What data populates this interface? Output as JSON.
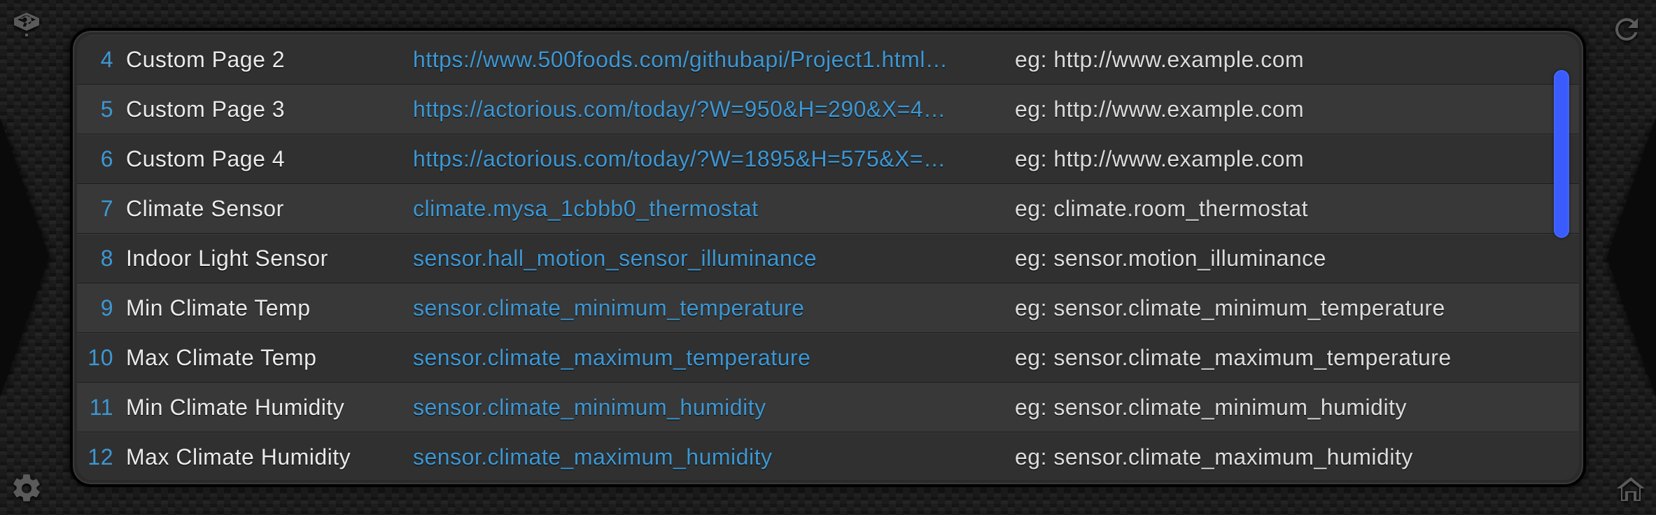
{
  "rows": [
    {
      "index": "4",
      "label": "Custom Page 2",
      "value": "https://www.500foods.com/githubapi/Project1.html…",
      "example": "eg: http://www.example.com"
    },
    {
      "index": "5",
      "label": "Custom Page 3",
      "value": "https://actorious.com/today/?W=950&H=290&X=4…",
      "example": "eg: http://www.example.com"
    },
    {
      "index": "6",
      "label": "Custom Page 4",
      "value": "https://actorious.com/today/?W=1895&H=575&X=…",
      "example": "eg: http://www.example.com"
    },
    {
      "index": "7",
      "label": "Climate Sensor",
      "value": "climate.mysa_1cbbb0_thermostat",
      "example": "eg: climate.room_thermostat"
    },
    {
      "index": "8",
      "label": "Indoor Light Sensor",
      "value": "sensor.hall_motion_sensor_illuminance",
      "example": "eg: sensor.motion_illuminance"
    },
    {
      "index": "9",
      "label": "Min Climate Temp",
      "value": "sensor.climate_minimum_temperature",
      "example": "eg: sensor.climate_minimum_temperature"
    },
    {
      "index": "10",
      "label": "Max Climate Temp",
      "value": "sensor.climate_maximum_temperature",
      "example": "eg: sensor.climate_maximum_temperature"
    },
    {
      "index": "11",
      "label": "Min Climate Humidity",
      "value": "sensor.climate_minimum_humidity",
      "example": "eg: sensor.climate_minimum_humidity"
    },
    {
      "index": "12",
      "label": "Max Climate Humidity",
      "value": "sensor.climate_maximum_humidity",
      "example": "eg: sensor.climate_maximum_humidity"
    }
  ]
}
